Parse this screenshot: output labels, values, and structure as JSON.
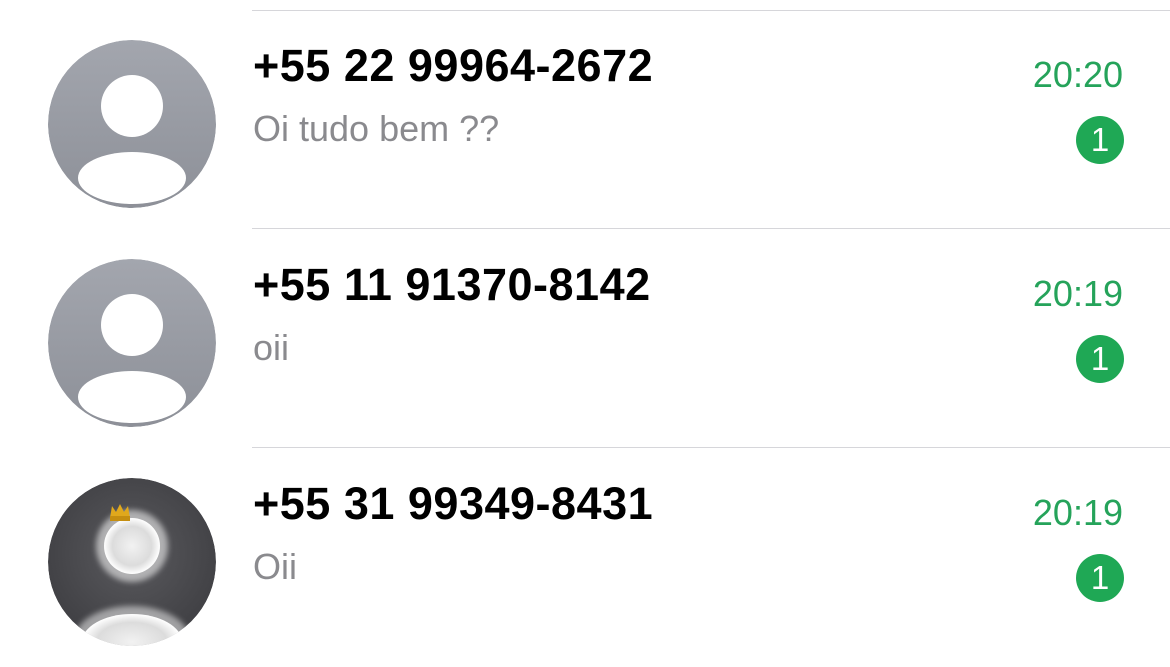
{
  "chats": [
    {
      "name": "+55 22 99964-2672",
      "preview": "Oi tudo bem ??",
      "time": "20:20",
      "unread_count": "1",
      "avatar_icon": "default-avatar-icon"
    },
    {
      "name": "+55 11 91370-8142",
      "preview": "oii",
      "time": "20:19",
      "unread_count": "1",
      "avatar_icon": "default-avatar-icon"
    },
    {
      "name": "+55 31 99349-8431",
      "preview": "Oii",
      "time": "20:19",
      "unread_count": "1",
      "avatar_icon": "profile-photo"
    }
  ],
  "colors": {
    "timestamp": "#25a35a",
    "badge": "#1fa855",
    "preview_text": "#8a8a8e",
    "divider": "#d6d6da"
  }
}
